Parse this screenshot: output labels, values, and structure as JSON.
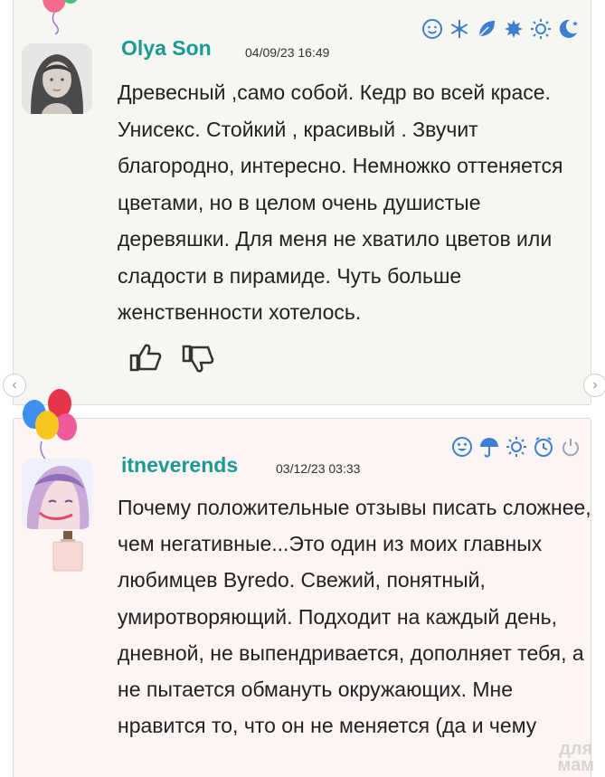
{
  "reviews": [
    {
      "username": "Olya Son",
      "date": "04/09/23 16:49",
      "text": "Древесный ,само собой. Кедр во всей красе. Унисекс. Стойкий , красивый . Звучит благородно, интересно. Немножко оттеняется цветами, но в целом очень душистые деревяшки. Для меня не хватило цветов или сладости в пирамиде. Чуть больше женственности хотелось.",
      "icons": [
        "smile-icon",
        "snowflake-icon",
        "leaf-icon",
        "maple-leaf-icon",
        "sun-icon",
        "moon-icon"
      ]
    },
    {
      "username": "itneverends",
      "date": "03/12/23 03:33",
      "text": "Почему положительные отзывы писать сложнее, чем негативные...Это один из моих главных любимцев Byredo. Свежий, понятный, умиротворяющий. Подходит на каждый день, дневной, не выпендривается, дополняет тебя, а не пытается обмануть окружающих. Мне нравится то, что он не меняется (да и чему",
      "icons": [
        "love-smile-icon",
        "umbrella-icon",
        "sun-icon",
        "clock-icon",
        "power-icon"
      ]
    }
  ],
  "watermark": {
    "line1": "для",
    "line2": "мам"
  },
  "nav": {
    "prev": "‹",
    "next": "›"
  },
  "colors": {
    "username": "#1a9a93",
    "icons": "#3d7fd1"
  }
}
